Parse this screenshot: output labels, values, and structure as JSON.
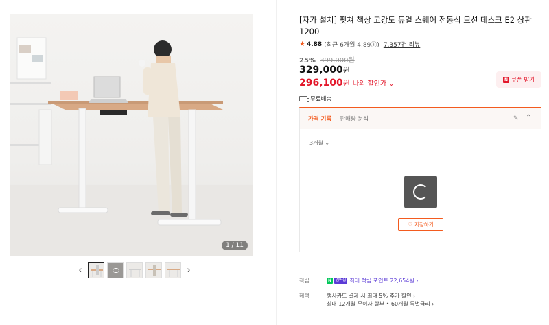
{
  "gallery": {
    "counter": "1 / 11",
    "prev_arrow": "‹",
    "next_arrow": "›",
    "thumbnail_count": 5
  },
  "product": {
    "title": "[자가 설치] 핏쳐 책상 고강도 듀얼 스퀘어 전동식 모션 데스크 E2 상판 1200",
    "rating": "4.88",
    "rating_recent": "(최근 6개월 4.89ⓘ)",
    "review_count": "7,357건 리뷰",
    "discount_pct": "25%",
    "original_price": "399,000원",
    "price": "329,000",
    "price_unit": "원",
    "my_price": "296,100",
    "my_price_unit": "원",
    "my_price_label": "나의 할인가 ⌄",
    "coupon_label": "쿠폰 받기",
    "coupon_icon": "N",
    "shipping": "무료배송"
  },
  "history": {
    "tab_active": "가격 기록",
    "tab_inactive": "판매량 분석",
    "period": "3개월 ⌄",
    "save_label": "저장하기",
    "save_icon": "♡",
    "edit_icon": "✎",
    "collapse_icon": "⌃"
  },
  "benefits": {
    "points_label": "적립",
    "npay_badge": "N",
    "membership_badge": "멤버십",
    "points_text": "최대 적립 포인트 22,654원 ›",
    "benefit_label": "혜택",
    "benefit_line1": "행사카드 결제 시 최대 5% 추가 할인 ›",
    "benefit_line2": "최대 12개월 무이자 할부 • 60개월 특별금리 ›"
  },
  "colors": {
    "accent_orange": "#f35b1f",
    "sale_red": "#e3182b",
    "npay_green": "#03c75a",
    "membership_purple": "#5b3bd6"
  }
}
